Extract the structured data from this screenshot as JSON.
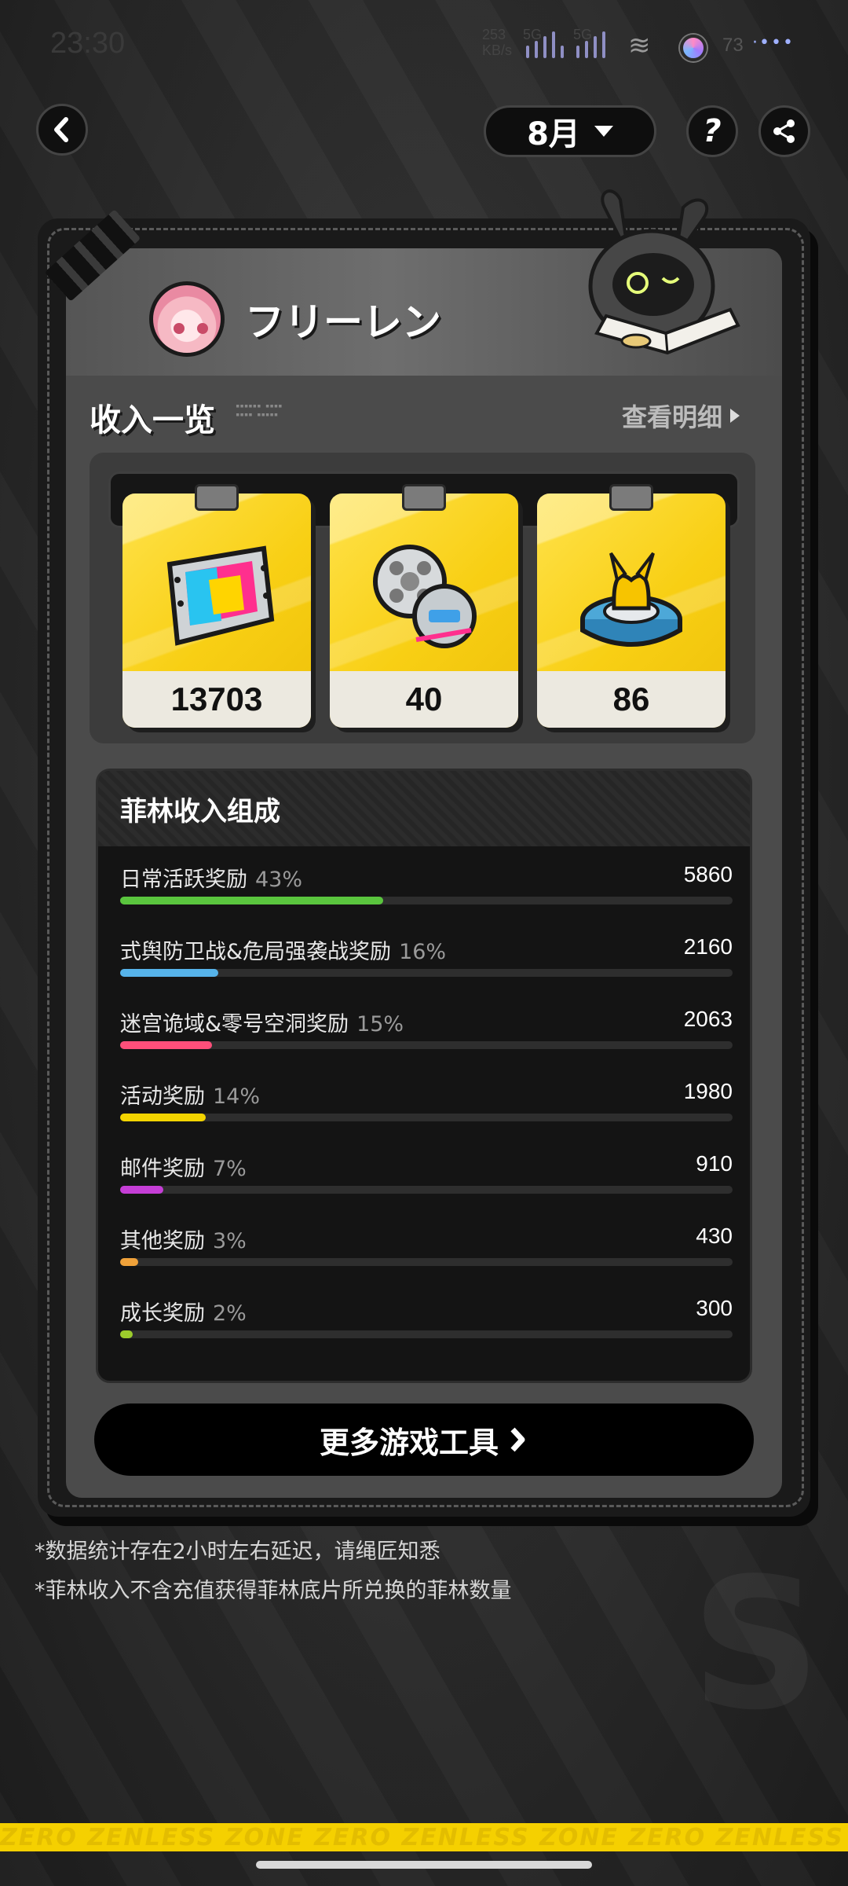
{
  "status_bar": {
    "time": "23:30",
    "net_speed": "253",
    "net_unit": "KB/s",
    "sim1": "5G",
    "sim2": "5G",
    "battery": "73"
  },
  "nav": {
    "month": "8月"
  },
  "profile": {
    "username": "フリーレン"
  },
  "income": {
    "title": "收入一览",
    "detail_link": "查看明细",
    "tiles": [
      {
        "name": "film-reel-icon",
        "value": "13703"
      },
      {
        "name": "film-reels-icon",
        "value": "40"
      },
      {
        "name": "bangboo-tower-icon",
        "value": "86"
      }
    ]
  },
  "composition": {
    "title": "菲林收入组成",
    "rows": [
      {
        "label": "日常活跃奖励",
        "pct": "43%",
        "value": "5860",
        "fraction": 0.43,
        "color": "#5ac53e"
      },
      {
        "label": "式舆防卫战&危局强袭战奖励",
        "pct": "16%",
        "value": "2160",
        "fraction": 0.16,
        "color": "#56b3ea"
      },
      {
        "label": "迷宫诡域&零号空洞奖励",
        "pct": "15%",
        "value": "2063",
        "fraction": 0.15,
        "color": "#ff4f7a"
      },
      {
        "label": "活动奖励",
        "pct": "14%",
        "value": "1980",
        "fraction": 0.14,
        "color": "#f3d400"
      },
      {
        "label": "邮件奖励",
        "pct": "7%",
        "value": "910",
        "fraction": 0.07,
        "color": "#c53ed6"
      },
      {
        "label": "其他奖励",
        "pct": "3%",
        "value": "430",
        "fraction": 0.03,
        "color": "#f0a23a"
      },
      {
        "label": "成长奖励",
        "pct": "2%",
        "value": "300",
        "fraction": 0.02,
        "color": "#9ccc2c"
      }
    ]
  },
  "more_tools": "更多游戏工具",
  "notes": [
    "*数据统计存在2小时左右延迟，请绳匠知悉",
    "*菲林收入不含充值获得菲林底片所兑换的菲林数量"
  ],
  "ticker": "ZERO ZENLESS ZONE ZERO ZENLESS ZONE ZERO ZENLESS ZONE ZERO"
}
